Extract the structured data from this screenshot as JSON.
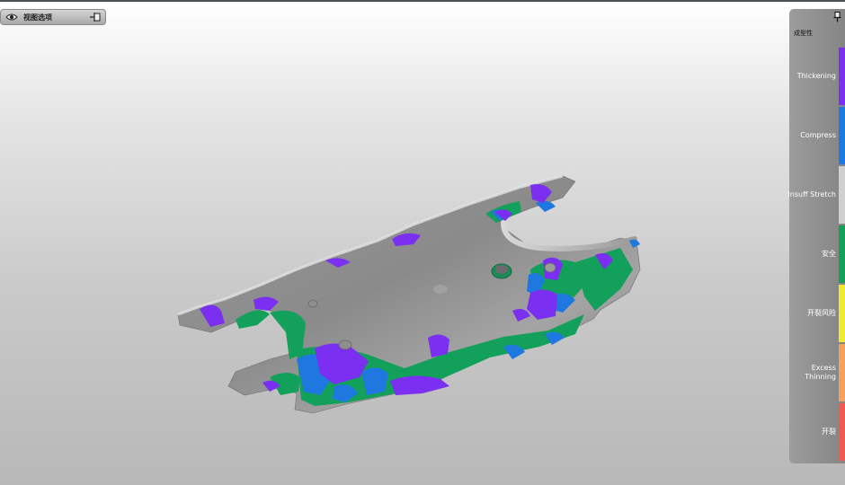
{
  "toolbar": {
    "view_options_label": "视图选项",
    "eye_icon": "eye-icon",
    "pin_icon": "pin-icon"
  },
  "legend": {
    "title": "成型性",
    "entries": [
      {
        "label": "Thickening",
        "color": "#7b2ff0"
      },
      {
        "label": "Compress",
        "color": "#1f78e0"
      },
      {
        "label": "Insuff Stretch",
        "color": "#cfcfcf"
      },
      {
        "label": "安全",
        "color": "#12a05a"
      },
      {
        "label": "开裂风险",
        "color": "#f2ea2c"
      },
      {
        "label": "Excess Thinning",
        "color": "#f3a25e"
      },
      {
        "label": "开裂",
        "color": "#ee5b4f"
      }
    ]
  },
  "colors": {
    "part_gray": "#8c8c8c",
    "purple": "#7b2ff0",
    "blue": "#1f78e0",
    "green": "#12a05a"
  }
}
